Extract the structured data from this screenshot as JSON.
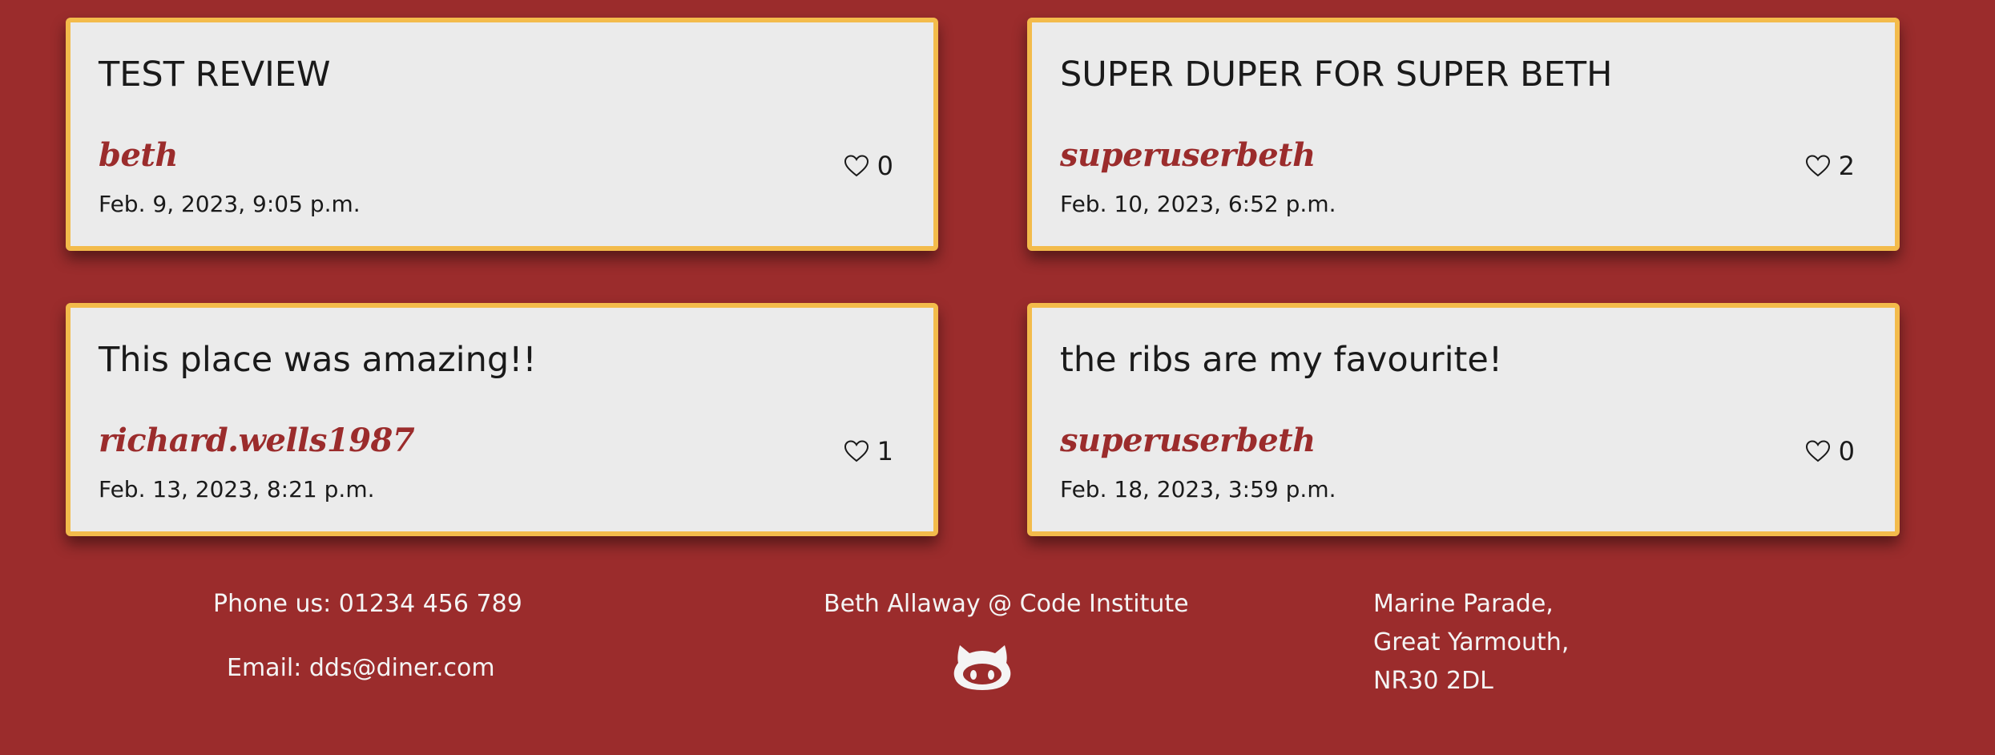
{
  "reviews": [
    {
      "title": "TEST REVIEW",
      "author": "beth",
      "date": "Feb. 9, 2023, 9:05 p.m.",
      "likes": "0"
    },
    {
      "title": "SUPER DUPER FOR SUPER BETH",
      "author": "superuserbeth",
      "date": "Feb. 10, 2023, 6:52 p.m.",
      "likes": "2"
    },
    {
      "title": "This place was amazing!!",
      "author": "richard.wells1987",
      "date": "Feb. 13, 2023, 8:21 p.m.",
      "likes": "1"
    },
    {
      "title": "the ribs are my favourite!",
      "author": "superuserbeth",
      "date": "Feb. 18, 2023, 3:59 p.m.",
      "likes": "0"
    }
  ],
  "footer": {
    "phone": "Phone us: 01234 456 789",
    "email": "Email: dds@diner.com",
    "credit": "Beth Allaway @ Code Institute",
    "github_icon": "github-icon",
    "address": [
      "Marine Parade,",
      "Great Yarmouth,",
      "NR30 2DL"
    ]
  },
  "colors": {
    "background": "#9b2c2c",
    "card": "#ebebeb",
    "card_border": "#f3bb4b",
    "author": "#9b2c2c",
    "footer_text": "#f4f4f4"
  }
}
